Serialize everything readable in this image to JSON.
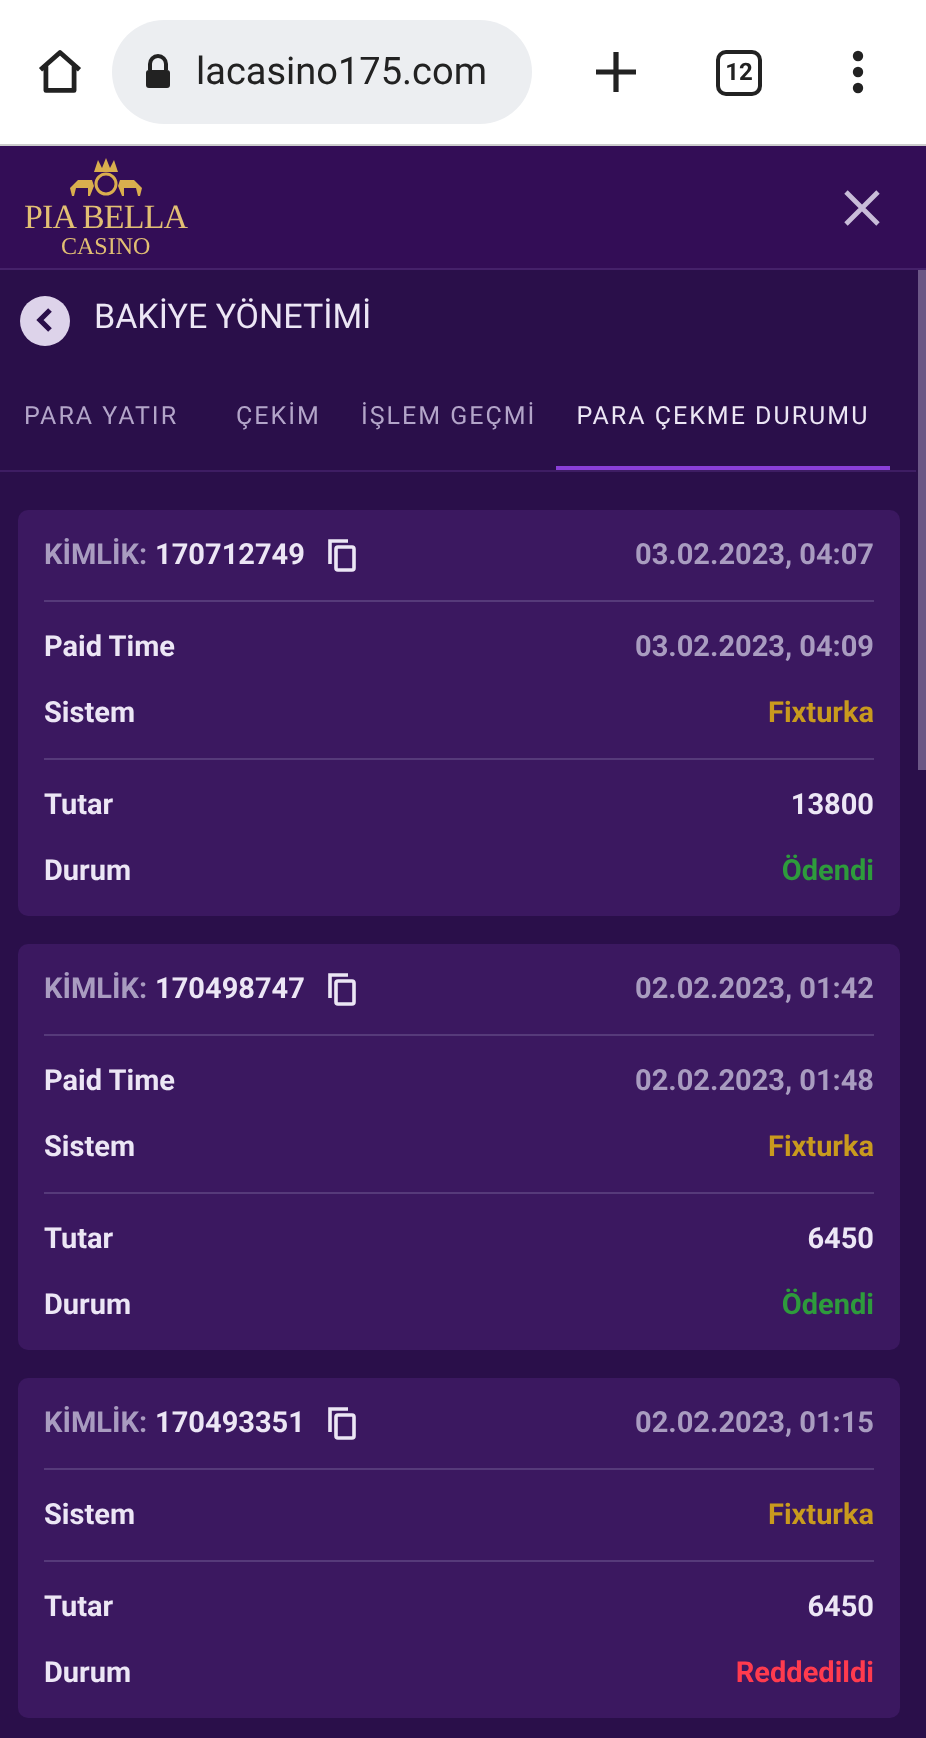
{
  "browser": {
    "url": "lacasino175.com",
    "tab_count": "12"
  },
  "header": {
    "logo_line1": "PIA BELLA",
    "logo_line2": "CASINO"
  },
  "page_title": "BAKİYE YÖNETİMİ",
  "tabs": [
    {
      "label": "PARA YATIR",
      "selected": false
    },
    {
      "label": "ÇEKİM",
      "selected": false
    },
    {
      "label": "İŞLEM GEÇMİ",
      "selected": false
    },
    {
      "label": "PARA ÇEKME DURUMU",
      "selected": true
    }
  ],
  "cards": [
    {
      "id_label": "KİMLİK:",
      "id": "170712749",
      "date": "03.02.2023, 04:07",
      "groups": [
        [
          {
            "label": "Paid Time",
            "value": "03.02.2023, 04:09",
            "kind": "time"
          },
          {
            "label": "Sistem",
            "value": "Fixturka",
            "kind": "system"
          }
        ],
        [
          {
            "label": "Tutar",
            "value": "13800",
            "kind": "amount"
          },
          {
            "label": "Durum",
            "value": "Ödendi",
            "kind": "status",
            "color": "#2e9b3c"
          }
        ]
      ]
    },
    {
      "id_label": "KİMLİK:",
      "id": "170498747",
      "date": "02.02.2023, 01:42",
      "groups": [
        [
          {
            "label": "Paid Time",
            "value": "02.02.2023, 01:48",
            "kind": "time"
          },
          {
            "label": "Sistem",
            "value": "Fixturka",
            "kind": "system"
          }
        ],
        [
          {
            "label": "Tutar",
            "value": "6450",
            "kind": "amount"
          },
          {
            "label": "Durum",
            "value": "Ödendi",
            "kind": "status",
            "color": "#2e9b3c"
          }
        ]
      ]
    },
    {
      "id_label": "KİMLİK:",
      "id": "170493351",
      "date": "02.02.2023, 01:15",
      "groups": [
        [
          {
            "label": "Sistem",
            "value": "Fixturka",
            "kind": "system"
          }
        ],
        [
          {
            "label": "Tutar",
            "value": "6450",
            "kind": "amount"
          },
          {
            "label": "Durum",
            "value": "Reddedildi",
            "kind": "status",
            "color": "#ff3b4e"
          }
        ]
      ]
    }
  ]
}
